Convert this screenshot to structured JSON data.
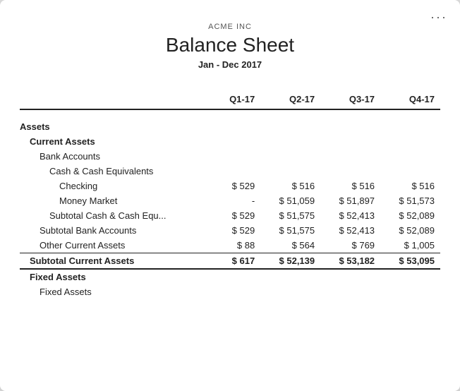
{
  "window": {
    "menu_dots": "···"
  },
  "header": {
    "company": "ACME INC",
    "title": "Balance Sheet",
    "period": "Jan - Dec 2017"
  },
  "columns": {
    "headers": [
      "",
      "Q1-17",
      "Q2-17",
      "Q3-17",
      "Q4-17"
    ]
  },
  "sections": {
    "assets_label": "Assets",
    "current_assets_label": "Current Assets",
    "bank_accounts_label": "Bank Accounts",
    "cash_equiv_label": "Cash & Cash Equivalents",
    "checking_label": "Checking",
    "checking_vals": [
      "$ 529",
      "$ 516",
      "$ 516",
      "$ 516"
    ],
    "money_market_label": "Money Market",
    "money_market_vals": [
      "-",
      "$ 51,059",
      "$ 51,897",
      "$ 51,573"
    ],
    "subtotal_cash_label": "Subtotal Cash & Cash Equ...",
    "subtotal_cash_vals": [
      "$ 529",
      "$ 51,575",
      "$ 52,413",
      "$ 52,089"
    ],
    "subtotal_bank_label": "Subtotal Bank Accounts",
    "subtotal_bank_vals": [
      "$ 529",
      "$ 51,575",
      "$ 52,413",
      "$ 52,089"
    ],
    "other_current_label": "Other Current Assets",
    "other_current_vals": [
      "$ 88",
      "$ 564",
      "$ 769",
      "$ 1,005"
    ],
    "subtotal_current_label": "Subtotal Current Assets",
    "subtotal_current_vals": [
      "$ 617",
      "$ 52,139",
      "$ 53,182",
      "$ 53,095"
    ],
    "fixed_assets_label": "Fixed Assets",
    "fixed_assets_sub_label": "Fixed Assets"
  }
}
